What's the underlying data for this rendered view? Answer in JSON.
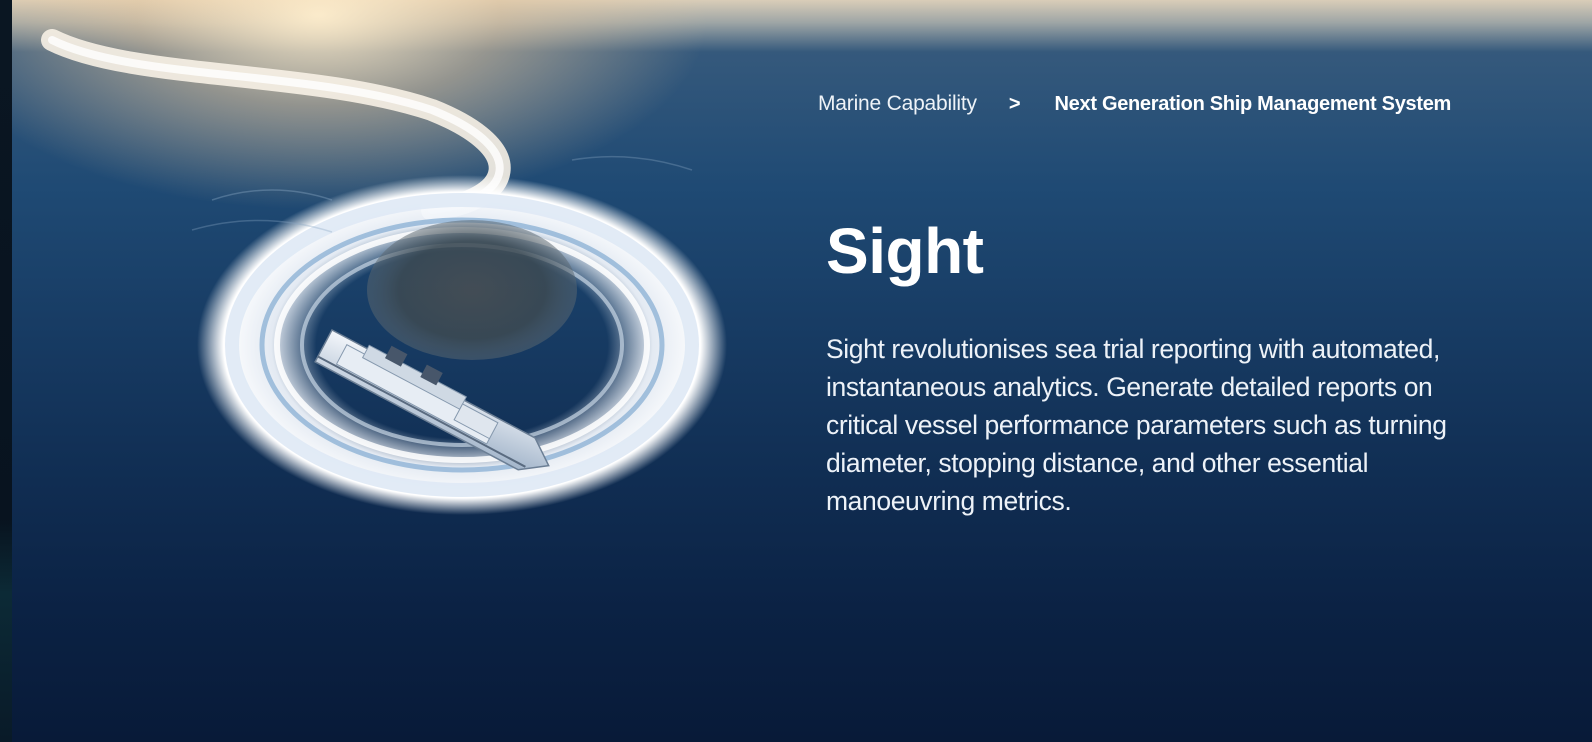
{
  "breadcrumb": {
    "parent": "Marine Capability",
    "separator": ">",
    "current": "Next Generation Ship Management System"
  },
  "hero": {
    "title": "Sight",
    "description": "Sight revolutionises sea trial reporting with automated, instantaneous analytics. Generate detailed reports on critical vessel performance parameters such as turning diameter, stopping distance, and other essential manoeuvring metrics."
  },
  "colors": {
    "ocean_dark": "#081a38",
    "ocean_mid": "#1f4a74",
    "sun_glow": "#ffeecd",
    "text": "#ffffff"
  },
  "icons": {
    "breadcrumb_separator": "chevron-right"
  }
}
